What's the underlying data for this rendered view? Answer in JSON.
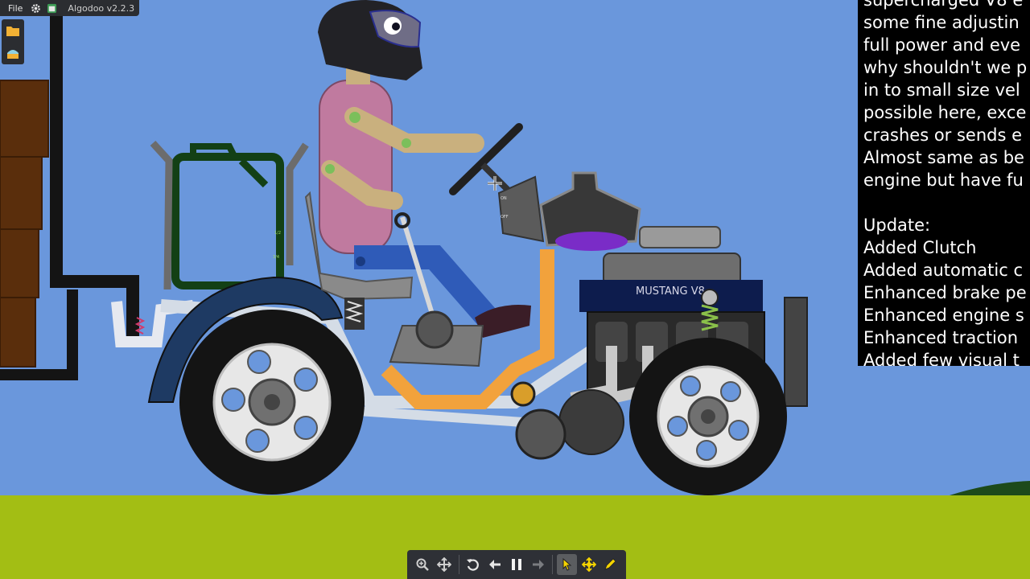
{
  "app": {
    "title": "Algodoo v2.2.3",
    "menu_file": "File"
  },
  "top_icons": [
    "gear-icon",
    "window-icon"
  ],
  "side_icons": [
    "folder-icon",
    "scene-icon"
  ],
  "scene": {
    "engine_label": "MUSTANG V8",
    "lever_labels": [
      "ON",
      "OFF"
    ],
    "gauge_labels": [
      "1/2",
      "3/4"
    ],
    "colors": {
      "sky": "#6a97dc",
      "ground": "#a3be14",
      "seat_frame": "#d99e4a",
      "body_shirt": "#c07a9f",
      "skin": "#c9b07e",
      "pants": "#2f5bb8",
      "engine_block": "#0d1c4d",
      "tire": "#141414",
      "rim": "#e7e7e7"
    }
  },
  "text_panel": {
    "lines": [
      "supercharged V8 e",
      "some fine adjustin",
      "full power and eve",
      "why shouldn't we p",
      "in to small size vel",
      "possible here, exce",
      "crashes or sends e",
      "Almost same as be",
      "engine but have fu",
      "",
      "Update:",
      "Added Clutch",
      "Added automatic c",
      "Enhanced brake pe",
      "Enhanced engine s",
      "Enhanced traction",
      "Added few visual t"
    ]
  },
  "toolbar": {
    "buttons": [
      "zoom-icon",
      "pan-icon",
      "undo-icon",
      "back-icon",
      "pause-icon",
      "forward-icon",
      "pointer-icon",
      "move-icon",
      "pencil-icon"
    ],
    "active": "pointer-icon"
  }
}
